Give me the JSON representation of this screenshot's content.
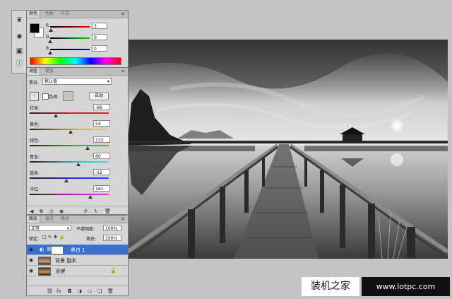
{
  "color_panel": {
    "tabs": [
      "颜色",
      "色板",
      "样式"
    ],
    "r_label": "R",
    "g_label": "G",
    "b_label": "B",
    "r_value": "3",
    "g_value": "0",
    "b_value": "0"
  },
  "adjust_panel": {
    "tabs": [
      "调整",
      "蒙版"
    ],
    "type_label": "黑白",
    "preset_value": "默认值",
    "tint_label": "色调",
    "auto_label": "自动",
    "sliders": [
      {
        "label": "红色:",
        "value": "-66",
        "color_a": "#e02020",
        "color_b": "#e02020",
        "pos": 0.33
      },
      {
        "label": "黄色:",
        "value": "54",
        "color_a": "#c8c800",
        "color_b": "#e0e000",
        "pos": 0.52
      },
      {
        "label": "绿色:",
        "value": "132",
        "color_a": "#30c030",
        "color_b": "#20d020",
        "pos": 0.73
      },
      {
        "label": "青色:",
        "value": "60",
        "color_a": "#20c0c0",
        "color_b": "#40e0e0",
        "pos": 0.62
      },
      {
        "label": "蓝色:",
        "value": "-12",
        "color_a": "#2030e0",
        "color_b": "#3040ff",
        "pos": 0.46
      },
      {
        "label": "洋红:",
        "value": "161",
        "color_a": "#c020c0",
        "color_b": "#e040e0",
        "pos": 0.77
      }
    ]
  },
  "layers_panel": {
    "tabs": [
      "图层",
      "通道",
      "路径"
    ],
    "blend_mode": "正常",
    "opacity_label": "不透明度:",
    "opacity_value": "100%",
    "lock_label": "锁定:",
    "fill_label": "填充:",
    "fill_value": "100%",
    "layers": [
      {
        "name": "黑白 1",
        "selected": true
      },
      {
        "name": "背景 副本",
        "selected": false
      },
      {
        "name": "背景",
        "selected": false
      }
    ]
  },
  "watermark": {
    "cn_text": "装机之家",
    "url_text": "www.lotpc.com"
  }
}
